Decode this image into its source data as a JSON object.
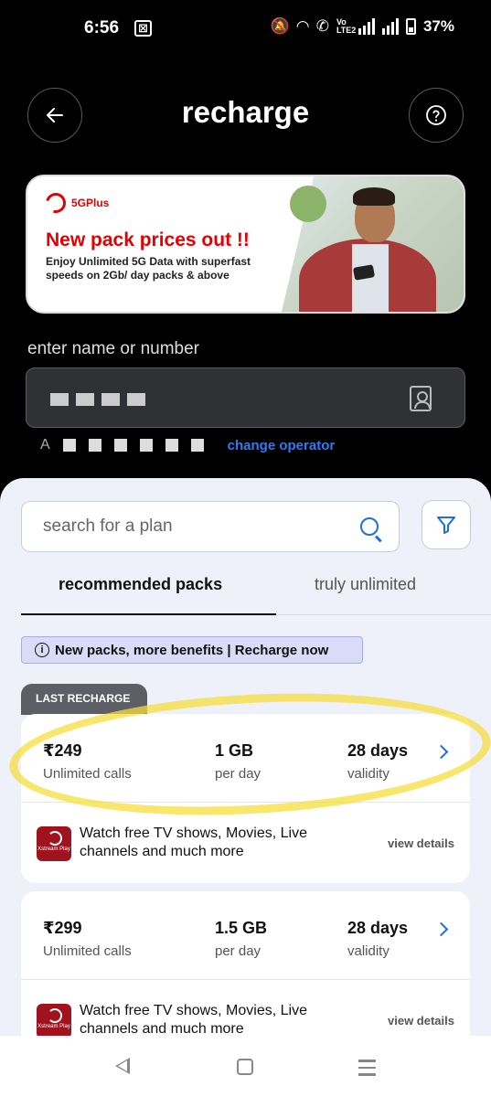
{
  "status_bar": {
    "time": "6:56",
    "notification_icon": "outlook-icon",
    "battery": "37%",
    "network_label": "Vo LTE2"
  },
  "header": {
    "title": "recharge",
    "back_icon": "arrow-left-icon",
    "help_icon": "question-icon"
  },
  "banner": {
    "brand": "5GPlus",
    "headline": "New pack prices out !!",
    "subtext": "Enjoy Unlimited 5G Data with superfast speeds on 2Gb/ day packs & above",
    "accent": "#e40000"
  },
  "number_entry": {
    "label": "enter name or number",
    "operator_prefix": "A",
    "change_operator": "change operator"
  },
  "plans": {
    "search_placeholder": "search for a plan",
    "tabs": [
      {
        "label": "recommended packs",
        "active": true
      },
      {
        "label": "truly unlimited",
        "active": false
      }
    ],
    "notice": "New packs, more benefits | Recharge now",
    "last_recharge_tag": "LAST RECHARGE",
    "cards": [
      {
        "price": "₹249",
        "calls": "Unlimited calls",
        "data": "1 GB",
        "data_period": "per day",
        "validity": "28 days",
        "validity_label": "validity",
        "app_name": "Xstream Play",
        "benefit": "Watch free TV shows, Movies, Live channels and much more",
        "view_details": "view details"
      },
      {
        "price": "₹299",
        "calls": "Unlimited calls",
        "data": "1.5 GB",
        "data_period": "per day",
        "validity": "28 days",
        "validity_label": "validity",
        "app_name": "Xstream Play",
        "benefit": "Watch free TV shows, Movies, Live channels and much more",
        "view_details": "view details"
      }
    ]
  },
  "colors": {
    "link_blue": "#2f7bf5",
    "icon_blue": "#1e6fd9",
    "sheet_bg": "#eef0fa",
    "highlight": "#f5de3c"
  }
}
